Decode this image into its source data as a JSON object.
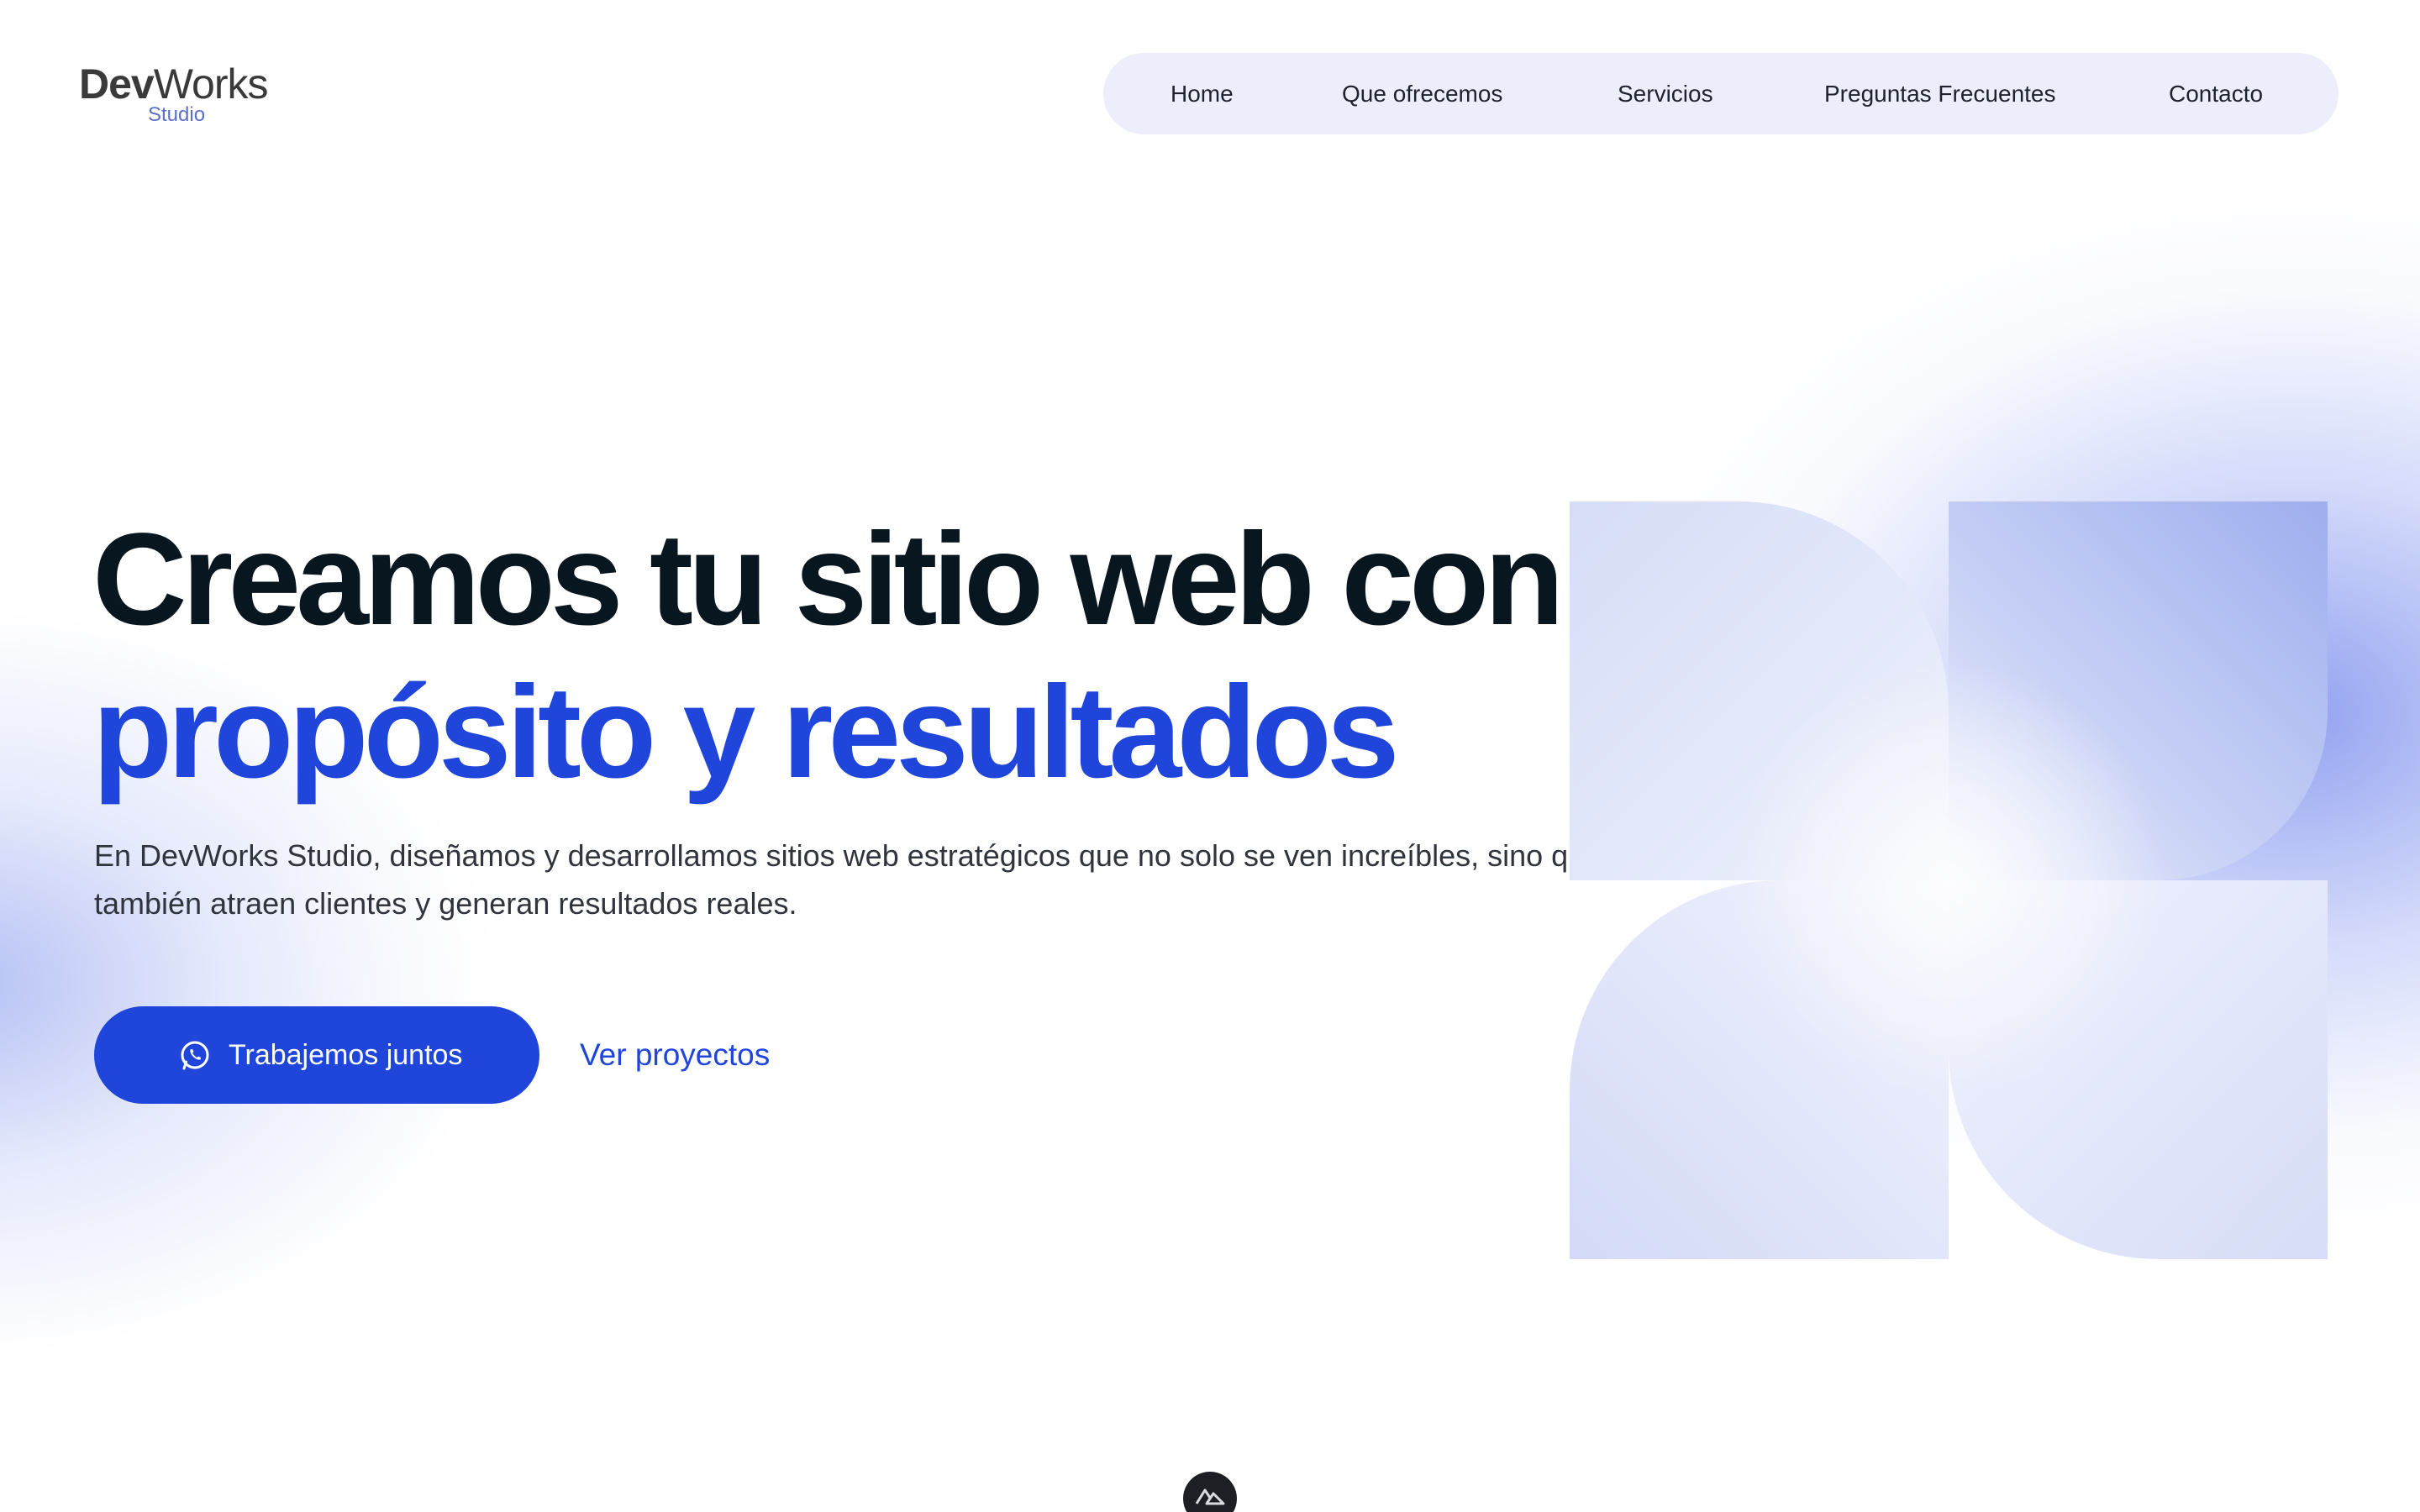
{
  "brand": {
    "logo_bold": "Dev",
    "logo_light": "Works",
    "logo_sub": "Studio"
  },
  "nav": {
    "items": [
      {
        "label": "Home"
      },
      {
        "label": "Que ofrecemos"
      },
      {
        "label": "Servicios"
      },
      {
        "label": "Preguntas Frecuentes"
      },
      {
        "label": "Contacto"
      }
    ]
  },
  "hero": {
    "title_line1": "Creamos tu sitio web con",
    "title_line2": "propósito y resultados",
    "description": "En DevWorks Studio, diseñamos y desarrollamos sitios web estratégicos que no solo se ven increíbles, sino que también atraen clientes y generan resultados reales.",
    "primary_cta": "Trabajemos juntos",
    "primary_cta_icon": "whatsapp-icon",
    "secondary_cta": "Ver proyectos"
  },
  "colors": {
    "accent": "#1f45db",
    "heading": "#07161f",
    "nav_bg": "#eceffb",
    "shape_light": "#dde3f8",
    "shape_mid": "#a9b7f0"
  },
  "scroll_badge_icon": "mountain-logo-icon"
}
